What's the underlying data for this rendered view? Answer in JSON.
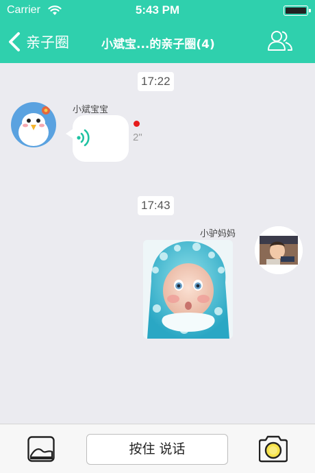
{
  "status_bar": {
    "carrier": "Carrier",
    "time": "5:43 PM"
  },
  "nav": {
    "back_label": "亲子圈",
    "title": "小斌宝...的亲子圈(4)"
  },
  "messages": [
    {
      "time": "17:22",
      "sender": "小斌宝宝",
      "type": "voice",
      "duration": "2\"",
      "unread": true
    },
    {
      "time": "17:43",
      "sender": "小驴妈妈",
      "type": "photo"
    }
  ],
  "toolbar": {
    "talk_label": "按住 说话"
  },
  "colors": {
    "accent": "#2fd0ad",
    "unread_dot": "#e61c1c",
    "background": "#ebebf0"
  },
  "icons": {
    "back": "chevron-left-icon",
    "members": "people-icon",
    "voice": "sound-wave-icon",
    "gallery": "image-icon",
    "camera": "camera-icon"
  }
}
